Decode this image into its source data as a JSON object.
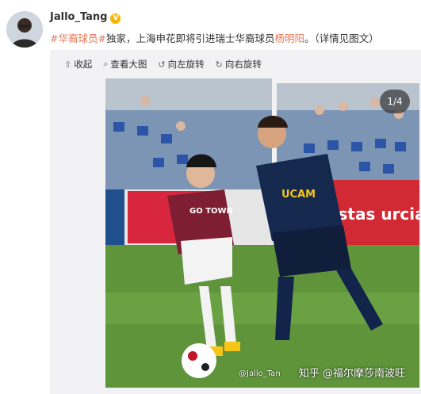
{
  "post": {
    "username": "Jallo_Tang",
    "verified_badge": "V",
    "text_hashtag": "#华裔球员#",
    "text_part1": "独家，上海申花即将引进瑞士华裔球员",
    "text_name": "杨明阳",
    "text_part2": "。（详情见图文）",
    "highlight_color": "#eb7350"
  },
  "toolbar": {
    "collapse_label": "收起",
    "view_large_label": "查看大图",
    "rotate_left_label": "向左旋转",
    "rotate_right_label": "向右旋转"
  },
  "photo": {
    "counter": "1/4",
    "jersey_left_text": "GO TOWN",
    "jersey_right_text": "UCAM",
    "banner_text": "astas urcia"
  },
  "watermarks": {
    "left": "@Jallo_Tan",
    "right": "知乎 @福尔摩莎南波旺"
  }
}
